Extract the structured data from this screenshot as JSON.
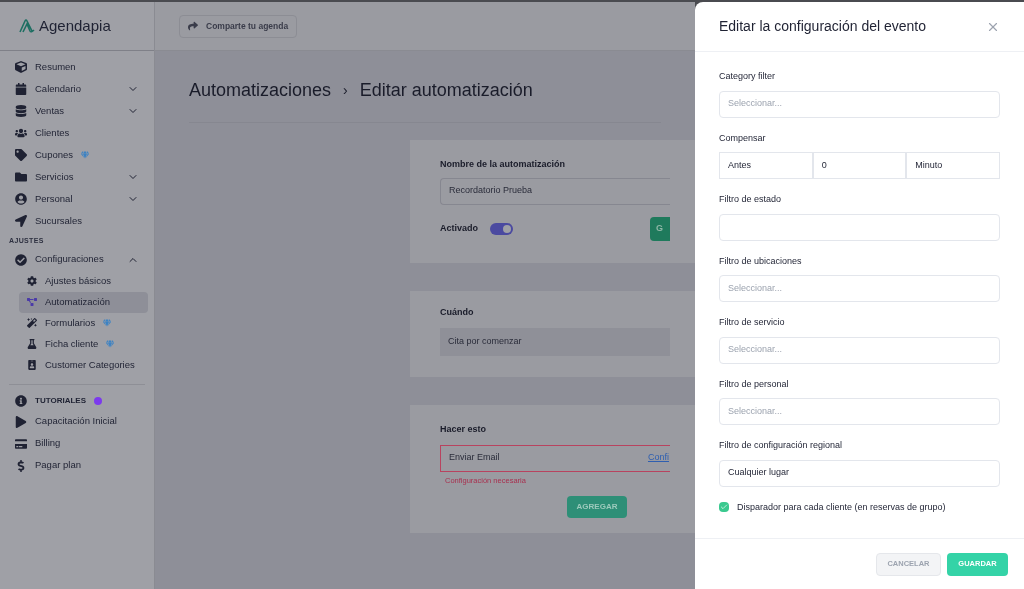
{
  "brand": "Agendapia",
  "share_button": "Comparte tu agenda",
  "sidebar": {
    "items": [
      {
        "label": "Resumen",
        "expandable": false,
        "premium": false,
        "selected": false
      },
      {
        "label": "Calendario",
        "expandable": true,
        "premium": false,
        "selected": false
      },
      {
        "label": "Ventas",
        "expandable": true,
        "premium": false,
        "selected": false
      },
      {
        "label": "Clientes",
        "expandable": false,
        "premium": false,
        "selected": false
      },
      {
        "label": "Cupones",
        "expandable": false,
        "premium": true,
        "selected": false
      },
      {
        "label": "Servicios",
        "expandable": true,
        "premium": false,
        "selected": false
      },
      {
        "label": "Personal",
        "expandable": true,
        "premium": false,
        "selected": false
      },
      {
        "label": "Sucursales",
        "expandable": false,
        "premium": false,
        "selected": false
      }
    ],
    "section": "AJUSTES",
    "settings": {
      "label": "Configuraciones",
      "expanded": true,
      "children": [
        {
          "label": "Ajustes básicos",
          "premium": false,
          "selected": false
        },
        {
          "label": "Automatización",
          "premium": false,
          "selected": true
        },
        {
          "label": "Formularios",
          "premium": true,
          "selected": false
        },
        {
          "label": "Ficha cliente",
          "premium": true,
          "selected": false
        },
        {
          "label": "Customer Categories",
          "premium": false,
          "selected": false
        }
      ]
    },
    "tutorials": "TUTORIALES",
    "bottom": [
      {
        "label": "Capacitación Inicial"
      },
      {
        "label": "Billing"
      },
      {
        "label": "Pagar plan"
      }
    ]
  },
  "breadcrumb": [
    "Automatizaciones",
    "›",
    "Editar automatización"
  ],
  "name_card": {
    "label": "Nombre de la automatización",
    "value": "Recordatorio Prueba",
    "toggle_label": "Activado",
    "on": true,
    "button": "G"
  },
  "when_card": {
    "label": "Cuándo",
    "value": "Cita por comenzar"
  },
  "do_card": {
    "label": "Hacer esto",
    "action": "Enviar Email",
    "link": "Confi",
    "error": "Configuración necesaria",
    "add_button": "AGREGAR"
  },
  "drawer": {
    "title": "Editar la configuración del evento",
    "fields": [
      {
        "kind": "select",
        "label": "Category filter",
        "placeholder": "Seleccionar..."
      },
      {
        "kind": "triple",
        "label": "Compensar",
        "values": [
          "Antes",
          "0",
          "Minuto"
        ]
      },
      {
        "kind": "select",
        "label": "Filtro de estado"
      },
      {
        "kind": "select",
        "label": "Filtro de ubicaciones",
        "placeholder": "Seleccionar..."
      },
      {
        "kind": "select",
        "label": "Filtro de servicio",
        "placeholder": "Seleccionar..."
      },
      {
        "kind": "select",
        "label": "Filtro de personal",
        "placeholder": "Seleccionar..."
      },
      {
        "kind": "value",
        "label": "Filtro de configuración regional",
        "value": "Cualquier lugar"
      }
    ],
    "checkbox": {
      "label": "Disparador para cada cliente (en reservas de grupo)",
      "checked": true
    },
    "cancel": "CANCELAR",
    "save": "GUARDAR"
  }
}
